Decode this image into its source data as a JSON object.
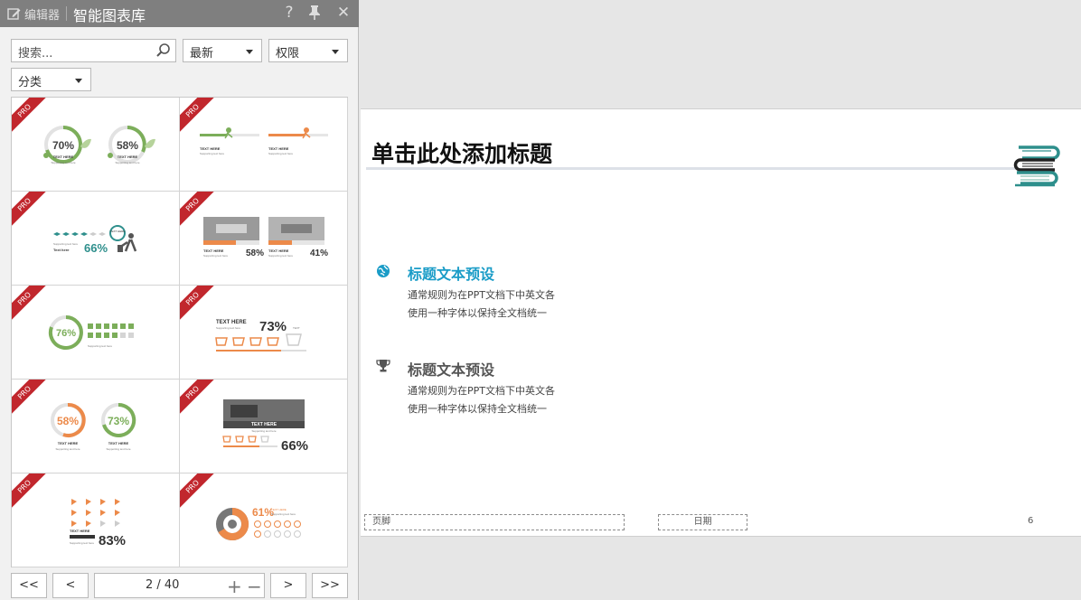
{
  "panel": {
    "editor_label": "编辑器",
    "title": "智能图表库",
    "help_icon": "?",
    "close_icon": "✕"
  },
  "filters": {
    "search_placeholder": "搜索...",
    "sort_value": "最新",
    "permission_value": "权限",
    "category_value": "分类"
  },
  "cards": [
    {
      "badge": "PRO",
      "pct_a": "70%",
      "pct_b": "58%",
      "label": "TEXT HERE",
      "sub": "Supporting text here"
    },
    {
      "badge": "PRO",
      "label": "TEXT HERE",
      "sub": "Supporting text here"
    },
    {
      "badge": "PRO",
      "pct": "66%",
      "label": "TEXT HERE",
      "sub": "Supporting text here",
      "small": "Text here"
    },
    {
      "badge": "PRO",
      "pct_a": "58%",
      "pct_b": "41%",
      "label": "TEXT HERE",
      "sub": "Supporting text here"
    },
    {
      "badge": "PRO",
      "pct": "76%",
      "sub": "Supporting text here"
    },
    {
      "badge": "PRO",
      "pct": "73%",
      "label": "TEXT HERE",
      "sub": "Supporting text here",
      "small": "TEXT"
    },
    {
      "badge": "PRO",
      "pct_a": "58%",
      "pct_b": "73%",
      "label": "TEXT HERE",
      "sub": "Supporting text here"
    },
    {
      "badge": "PRO",
      "pct": "66%",
      "label": "TEXT HERE",
      "sub": "Supporting text here"
    },
    {
      "badge": "PRO",
      "pct": "83%",
      "label": "TEXT HERE",
      "sub": "Supporting text here"
    },
    {
      "badge": "PRO",
      "pct": "61%",
      "label": "TEXT HERE",
      "sub": "Supporting text here"
    }
  ],
  "pager": {
    "first": "<<",
    "prev": "<",
    "indicator": "2 / 40",
    "next": ">",
    "last": ">>"
  },
  "slide": {
    "title": "单击此处添加标题",
    "sections": [
      {
        "heading": "标题文本预设",
        "line1": "通常规则为在PPT文档下中英文各",
        "line2": "使用一种字体以保持全文档统一",
        "color": "#1a9cc7",
        "icon": "globe-icon"
      },
      {
        "heading": "标题文本预设",
        "line1": "通常规则为在PPT文档下中英文各",
        "line2": "使用一种字体以保持全文档统一",
        "color": "#555555",
        "icon": "trophy-icon"
      }
    ],
    "footer_label": "页脚",
    "date_label": "日期",
    "page_number": "6"
  },
  "colors": {
    "accent_blue": "#1a9cc7",
    "pro_red": "#c1272d",
    "green": "#7cae5a",
    "orange": "#ec8a4a",
    "teal": "#2e8f8c"
  }
}
